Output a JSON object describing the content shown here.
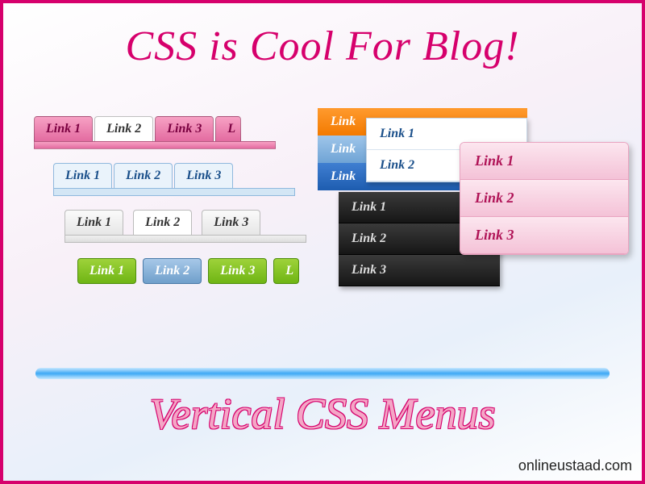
{
  "title": "CSS is Cool For Blog!",
  "footer_title": "Vertical CSS Menus",
  "watermark": "onlineustaad.com",
  "link_labels": {
    "l1": "Link 1",
    "l2": "Link 2",
    "l3": "Link 3",
    "l_partial": "L"
  },
  "tabs": {
    "pink": {
      "items": [
        "Link 1",
        "Link 2",
        "Link 3",
        "L"
      ],
      "active_index": 1
    },
    "blue": {
      "items": [
        "Link 1",
        "Link 2",
        "Link 3"
      ]
    },
    "grey": {
      "items": [
        "Link 1",
        "Link 2",
        "Link 3"
      ],
      "active_index": 1
    },
    "green": {
      "items": [
        "Link 1",
        "Link 2",
        "Link 3",
        "L"
      ],
      "active_index": 1
    }
  },
  "strips": {
    "orange": "Link",
    "lblue": "Link",
    "mblue": "Link"
  },
  "white_list": [
    "Link 1",
    "Link 2"
  ],
  "dark_list": [
    "Link 1",
    "Link 2",
    "Link 3"
  ],
  "pink_panel": [
    "Link 1",
    "Link 2",
    "Link 3"
  ]
}
